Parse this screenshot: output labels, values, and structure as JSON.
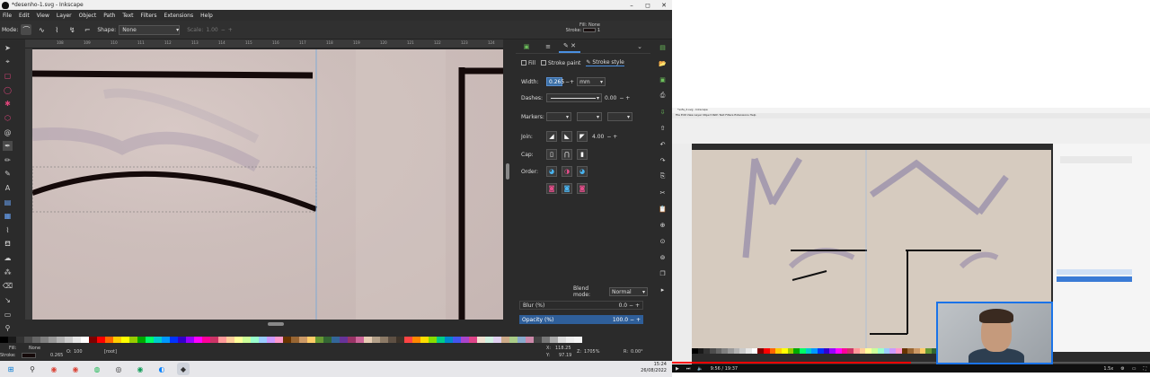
{
  "window": {
    "title": "*desenho-1.svg - Inkscape",
    "minimize": "–",
    "maximize": "◻",
    "close": "✕"
  },
  "menu": [
    "File",
    "Edit",
    "View",
    "Layer",
    "Object",
    "Path",
    "Text",
    "Filters",
    "Extensions",
    "Help"
  ],
  "tool_controls": {
    "mode_label": "Mode:",
    "shape_label": "Shape:",
    "shape_value": "None",
    "scale_label": "Scale:",
    "scale_value": "1.00"
  },
  "fill_stroke_indicator": {
    "fill_label": "Fill:",
    "fill_value": "None",
    "stroke_label": "Stroke:",
    "stroke_width": "1"
  },
  "ruler": {
    "ticks": [
      "108",
      "109",
      "110",
      "111",
      "112",
      "113",
      "114",
      "115",
      "116",
      "117",
      "118",
      "119",
      "120",
      "121",
      "122",
      "123",
      "124"
    ]
  },
  "dialog": {
    "tabs": {
      "fill": "Fill",
      "stroke_paint": "Stroke paint",
      "stroke_style": "Stroke style"
    },
    "width_label": "Width:",
    "width_value": "0.265",
    "width_unit": "mm",
    "dashes_label": "Dashes:",
    "dashes_value": "0.00",
    "markers_label": "Markers:",
    "join_label": "Join:",
    "join_value": "4.00",
    "cap_label": "Cap:",
    "order_label": "Order:",
    "blend_label": "Blend mode:",
    "blend_value": "Normal",
    "blur_label": "Blur (%)",
    "blur_value": "0.0",
    "opacity_label": "Opacity (%)",
    "opacity_value": "100.0"
  },
  "status": {
    "fill_label": "Fill:",
    "fill_value": "None",
    "stroke_label": "Stroke:",
    "stroke_value": "0.265",
    "opacity_label": "O:",
    "opacity_value": "100",
    "layer_value": "[root]",
    "x_label": "X:",
    "x_value": "118.25",
    "y_label": "Y:",
    "y_value": "97.19",
    "zoom_label": "Z:",
    "zoom_value": "1705%",
    "rotation_label": "R:",
    "rotation_value": "0.00°"
  },
  "taskbar": {
    "time": "15:24",
    "date": "26/08/2022"
  },
  "video": {
    "title": "*sofa_2.svg - Inkscape",
    "time_readout": "9:56 / 19:37",
    "speed": "1.5x"
  },
  "colors": {
    "accent": "#4a90e2",
    "opacity_bar": "#2f5f9a",
    "stroke": "#150a0a",
    "webcam_border": "#1a73e8"
  }
}
